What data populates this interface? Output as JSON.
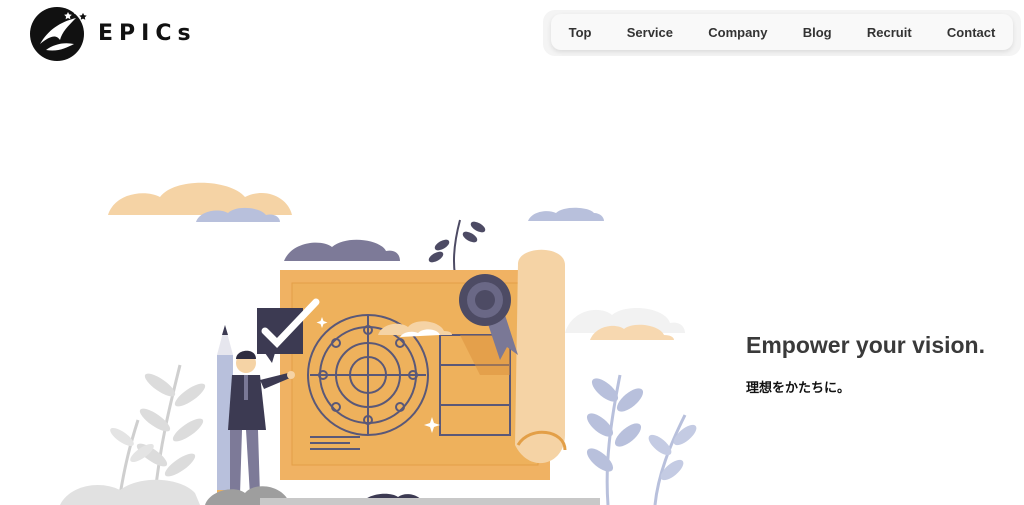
{
  "brand": {
    "name": "EPICs",
    "logo_icon": "phoenix-icon"
  },
  "nav": {
    "items": [
      {
        "label": "Top"
      },
      {
        "label": "Service"
      },
      {
        "label": "Company"
      },
      {
        "label": "Blog"
      },
      {
        "label": "Recruit"
      },
      {
        "label": "Contact"
      }
    ]
  },
  "hero": {
    "tagline": "Empower your vision.",
    "subtitle": "理想をかたちに。",
    "illustration": "businessman-blueprint-illustration"
  },
  "colors": {
    "accent_orange": "#eeb15c",
    "peach": "#f5d3a5",
    "slate": "#4d4b64",
    "lavender": "#b8c0dc"
  }
}
